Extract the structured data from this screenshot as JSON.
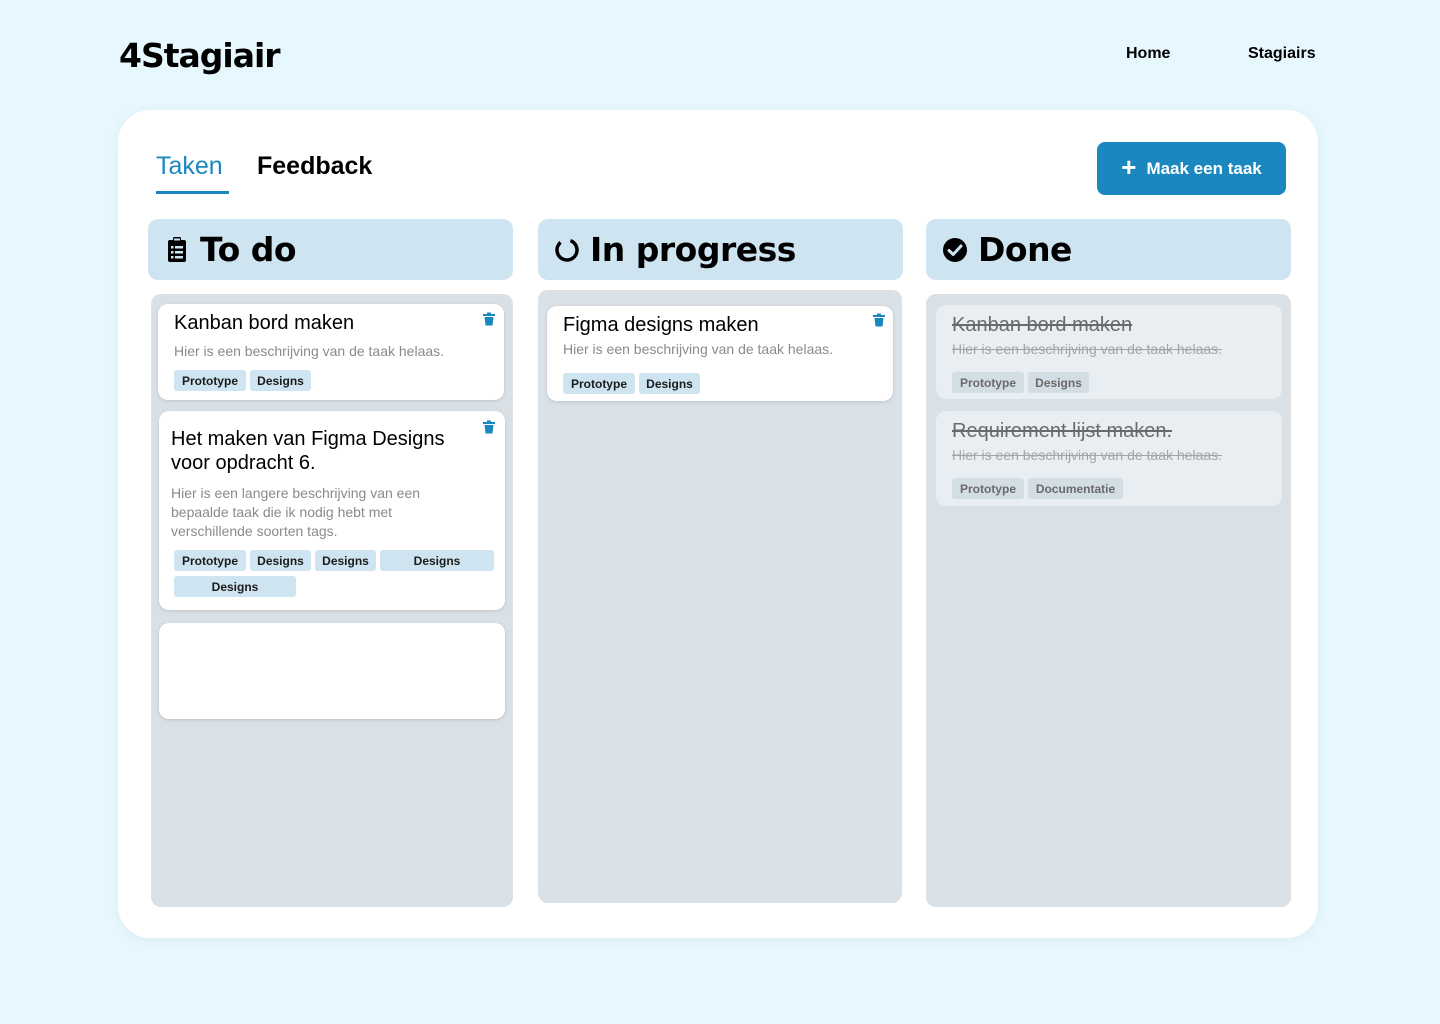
{
  "app": {
    "logo": "4Stagiair"
  },
  "nav": {
    "home": "Home",
    "stagiairs": "Stagiairs"
  },
  "tabs": {
    "active": "Taken",
    "other": "Feedback"
  },
  "new_task_button": "Maak een taak",
  "columns": {
    "todo": {
      "title": "To do",
      "icon": "clipboard-icon"
    },
    "progress": {
      "title": "In progress",
      "icon": "spinner-icon"
    },
    "done": {
      "title": "Done",
      "icon": "check-circle-icon"
    }
  },
  "todo_cards": [
    {
      "title": "Kanban bord maken",
      "description": "Hier is een beschrijving van de taak helaas.",
      "tags": [
        "Prototype",
        "Designs"
      ]
    },
    {
      "title": "Het maken van Figma Designs voor opdracht 6.",
      "description": "Hier is een langere beschrijving van een bepaalde taak die ik nodig hebt met verschillende soorten tags.",
      "tags": [
        "Prototype",
        "Designs",
        "Designs",
        "Designs",
        "Designs"
      ]
    }
  ],
  "progress_cards": [
    {
      "title": "Figma designs maken",
      "description": "Hier is een beschrijving van de taak helaas.",
      "tags": [
        "Prototype",
        "Designs"
      ]
    }
  ],
  "done_cards": [
    {
      "title": "Kanban bord maken",
      "description": "Hier is een beschrijving van de taak helaas.",
      "tags": [
        "Prototype",
        "Designs"
      ]
    },
    {
      "title": "Requirement lijst maken.",
      "description": "Hier is een beschrijving van de taak helaas.",
      "tags": [
        "Prototype",
        "Documentatie"
      ]
    }
  ],
  "colors": {
    "background": "#e6f8fe",
    "accent": "#1a88bf",
    "header": "#cfe4f1",
    "column": "#d9e0e6"
  }
}
